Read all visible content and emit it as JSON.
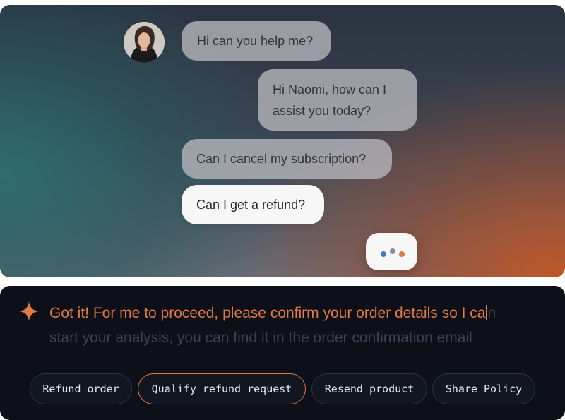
{
  "conversation": {
    "messages": [
      {
        "text": "Hi can you help me?",
        "style": "user"
      },
      {
        "lines": [
          "Hi Naomi, how can I",
          "assist you today?"
        ],
        "style": "agent"
      },
      {
        "text": "Can I cancel my subscription?",
        "style": "user"
      },
      {
        "text": "Can I get a refund?",
        "style": "user-highlight"
      }
    ],
    "typing_dot_colors": [
      "#3d7ec9",
      "#8a8e96",
      "#e07a45"
    ]
  },
  "assistant": {
    "response_text_before_caret": "Got it! For me to proceed, please confirm your order details so I ca",
    "response_text_after_caret": "n",
    "response_text_line2": "start your analysis, you can find it in the order confirmation email",
    "accent_color": "#e07a45"
  },
  "quick_actions": [
    {
      "label": "Refund order",
      "active": false
    },
    {
      "label": "Qualify refund request",
      "active": true
    },
    {
      "label": "Resend product",
      "active": false
    },
    {
      "label": "Share Policy",
      "active": false
    }
  ]
}
